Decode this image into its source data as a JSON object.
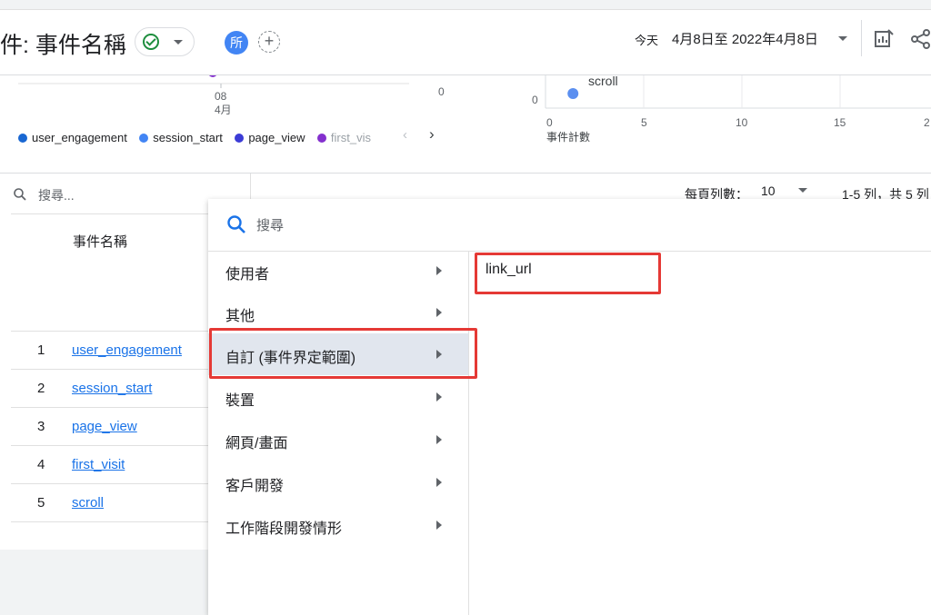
{
  "header": {
    "title": "件: 事件名稱",
    "avatar_text": "所",
    "add_symbol": "+",
    "date_today": "今天",
    "date_range": "4月8日至 2022年4月8日"
  },
  "chart_data": [
    {
      "type": "scatter",
      "tick_labels_x": [
        "08",
        "4月"
      ],
      "y_zero": "0",
      "legend": [
        "user_engagement",
        "session_start",
        "page_view",
        "first_vis"
      ],
      "legend_colors": [
        "#1967d2",
        "#4285f4",
        "#3c3cd6",
        "#8430ce"
      ]
    },
    {
      "type": "scatter",
      "y_zero": "0",
      "x_ticks": [
        "0",
        "5",
        "10",
        "15",
        "2"
      ],
      "xlabel": "事件計數",
      "points": [
        {
          "label": "scroll",
          "x": 1.4,
          "y": 0
        }
      ],
      "point_color": "#5b8ff0"
    }
  ],
  "table": {
    "search_placeholder": "搜尋...",
    "rows_per_page_label": "每頁列數：",
    "rows_per_page_value": "10",
    "pagination": "1-5 列，共 5 列",
    "column_header": "事件名稱",
    "rows": [
      {
        "num": "1",
        "name": "user_engagement"
      },
      {
        "num": "2",
        "name": "session_start"
      },
      {
        "num": "3",
        "name": "page_view"
      },
      {
        "num": "4",
        "name": "first_visit"
      },
      {
        "num": "5",
        "name": "scroll"
      }
    ]
  },
  "menu": {
    "search_placeholder": "搜尋",
    "items": [
      {
        "label": "使用者"
      },
      {
        "label": "其他"
      },
      {
        "label": "自訂 (事件界定範圍)"
      },
      {
        "label": "裝置"
      },
      {
        "label": "網頁/畫面"
      },
      {
        "label": "客戶開發"
      },
      {
        "label": "工作階段開發情形"
      }
    ],
    "sub_items": [
      {
        "label": "link_url"
      }
    ]
  },
  "colors": {
    "accent": "#1a73e8",
    "highlight": "#e53935",
    "selected": "#e1e6ee"
  }
}
